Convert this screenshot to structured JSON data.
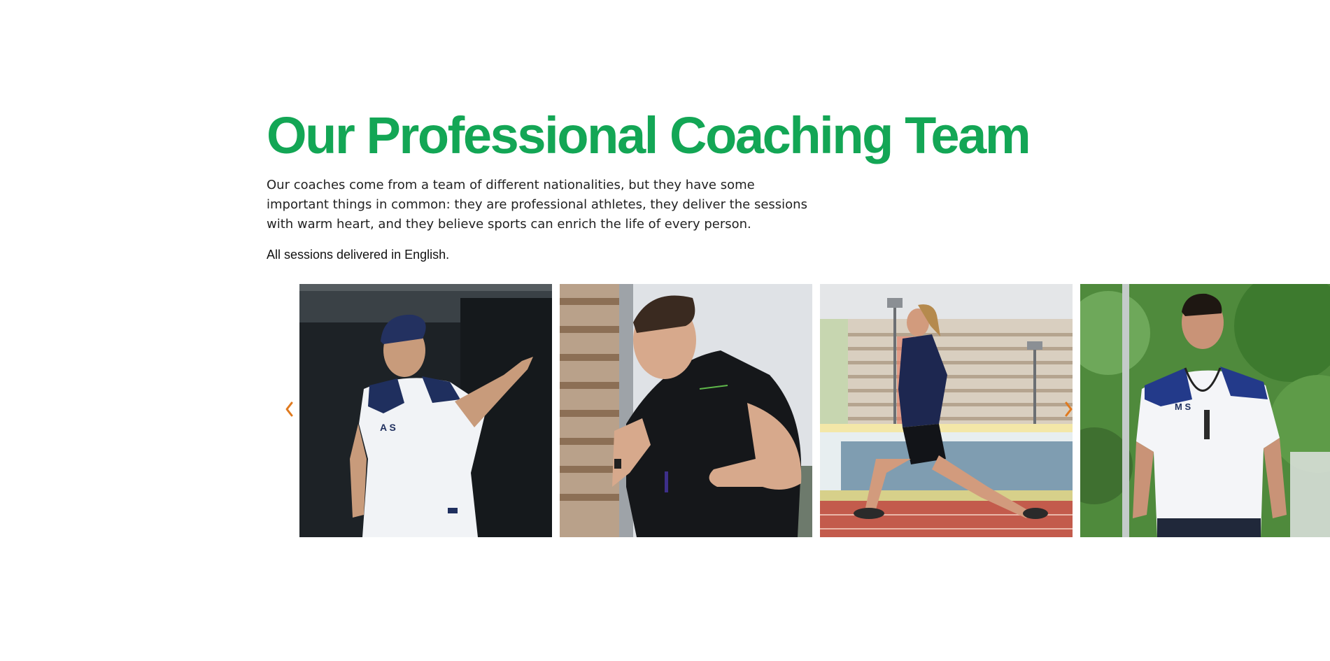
{
  "section": {
    "title": "Our Professional Coaching Team",
    "description": "Our coaches come from a team of different nationalities, but they have some important things in common: they are professional athletes, they deliver the sessions with warm heart, and they believe sports can enrich the life of every person.",
    "note": "All sessions delivered in English."
  },
  "colors": {
    "title_green": "#13a655",
    "arrow_orange": "#e07a1f"
  },
  "carousel": {
    "prev_icon": "chevron-left-icon",
    "next_icon": "chevron-right-icon",
    "cards": [
      {
        "name": "coach-photo-1",
        "jersey_initials": "A S"
      },
      {
        "name": "coach-photo-2",
        "jersey_initials": ""
      },
      {
        "name": "coach-photo-3",
        "jersey_initials": ""
      },
      {
        "name": "coach-photo-4",
        "jersey_initials": "M S"
      }
    ]
  }
}
